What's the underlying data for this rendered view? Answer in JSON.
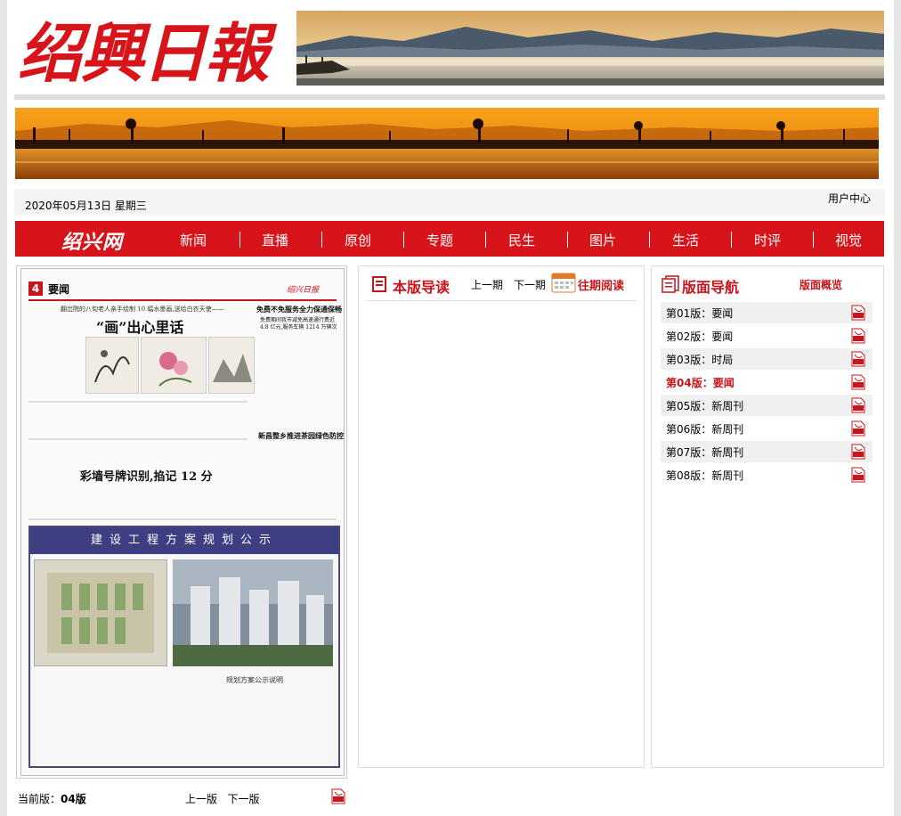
{
  "site": {
    "logo": "绍興日報",
    "user_center": "用户中心",
    "date": "2020年05月13日 星期三"
  },
  "nav": {
    "logo": "绍兴网",
    "items": [
      "新闻",
      "直播",
      "原创",
      "专题",
      "民生",
      "图片",
      "生活",
      "时评",
      "视觉"
    ]
  },
  "paper": {
    "page_num": "4",
    "section": "要闻",
    "brand": "绍兴日报",
    "deck": "翻岀院的八旬老人亲手绘制 10 幅水墨画,送给白衣天使——",
    "headline": "“画”出心里话",
    "side_headline": "免费不免服务全力保通保畅",
    "side_deck": "免费期间我市减免高速通行费近 4.8 亿元,服务车辆 1214 万辆次",
    "headline2": "彩墙号牌识别,掐记 12 分",
    "headline3": "新昌整乡推进茶园绿色防控",
    "ad_title": "建设工程方案规划公示",
    "ad_subtitle": "规划方案公示说明"
  },
  "footer": {
    "current_label": "当前版：",
    "current_value": "04版",
    "prev": "上一版",
    "next": "下一版"
  },
  "reading_guide": {
    "title": "本版导读",
    "prev_issue": "上一期",
    "next_issue": "下一期",
    "past_reading": "往期阅读"
  },
  "edition_nav": {
    "title": "版面导航",
    "overview": "版面概览",
    "current_index": 3,
    "items": [
      "第01版：要闻",
      "第02版：要闻",
      "第03版：时局",
      "第04版：要闻",
      "第05版：新周刊",
      "第06版：新周刊",
      "第07版：新周刊",
      "第08版：新周刊"
    ]
  },
  "colors": {
    "brand_red": "#d8141b",
    "ad_blue": "#3e3f83"
  },
  "icons": {
    "pdf": "pdf-icon",
    "calendar": "calendar-icon",
    "book": "book-icon",
    "pages": "pages-icon"
  }
}
